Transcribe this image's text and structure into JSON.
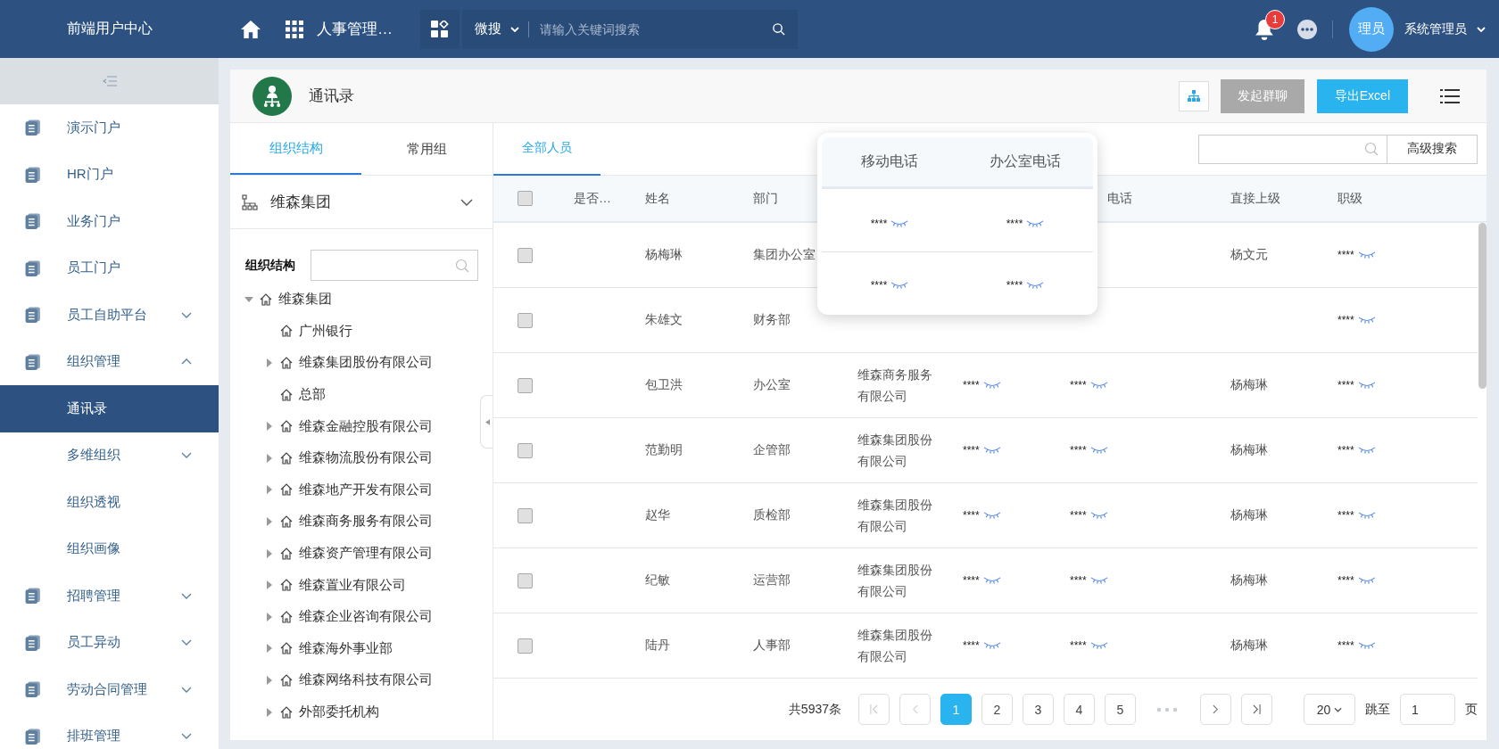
{
  "topbar": {
    "brand": "前端用户中心",
    "module": "人事管理…",
    "search": {
      "scope": "微搜",
      "placeholder": "请输入关键词搜索"
    },
    "notifications": "1",
    "user": {
      "avatar_text": "理员",
      "name": "系统管理员"
    }
  },
  "sidebar": {
    "items": [
      {
        "label": "演示门户",
        "kind": "page",
        "selected": false
      },
      {
        "label": "HR门户",
        "kind": "page",
        "selected": false
      },
      {
        "label": "业务门户",
        "kind": "page",
        "selected": false
      },
      {
        "label": "员工门户",
        "kind": "page",
        "selected": false
      },
      {
        "label": "员工自助平台",
        "kind": "folder",
        "expanded": false,
        "selected": false
      },
      {
        "label": "组织管理",
        "kind": "folder",
        "expanded": true,
        "selected": false
      },
      {
        "label": "通讯录",
        "kind": "sub",
        "selected": true
      },
      {
        "label": "多维组织",
        "kind": "subfolder",
        "expanded": false,
        "selected": false
      },
      {
        "label": "组织透视",
        "kind": "sub",
        "selected": false
      },
      {
        "label": "组织画像",
        "kind": "sub",
        "selected": false
      },
      {
        "label": "招聘管理",
        "kind": "folder",
        "expanded": false,
        "selected": false
      },
      {
        "label": "员工异动",
        "kind": "folder",
        "expanded": false,
        "selected": false
      },
      {
        "label": "劳动合同管理",
        "kind": "folder",
        "expanded": false,
        "selected": false
      },
      {
        "label": "排班管理",
        "kind": "folder",
        "expanded": false,
        "selected": false
      }
    ]
  },
  "page": {
    "title": "通讯录",
    "actions": [
      {
        "label": "发起群聊",
        "disabled": true
      },
      {
        "label": "导出Excel",
        "disabled": false
      }
    ]
  },
  "tree_panel": {
    "tabs": [
      {
        "label": "组织结构",
        "selected": true
      },
      {
        "label": "常用组",
        "selected": false
      }
    ],
    "org_select": "维森集团",
    "search_label": "组织结构",
    "tree": [
      {
        "label": "维森集团",
        "expanded": true,
        "children": [
          {
            "label": "广州银行"
          },
          {
            "label": "维森集团股份有限公司",
            "expanded": false
          },
          {
            "label": "总部"
          },
          {
            "label": "维森金融控股有限公司",
            "expanded": false
          },
          {
            "label": "维森物流股份有限公司",
            "expanded": false
          },
          {
            "label": "维森地产开发有限公司",
            "expanded": false
          },
          {
            "label": "维森商务服务有限公司",
            "expanded": false
          },
          {
            "label": "维森资产管理有限公司",
            "expanded": false
          },
          {
            "label": "维森置业有限公司",
            "expanded": false
          },
          {
            "label": "维森企业咨询有限公司",
            "expanded": false
          },
          {
            "label": "维森海外事业部",
            "expanded": false
          },
          {
            "label": "维森网络科技有限公司",
            "expanded": false
          },
          {
            "label": "外部委托机构",
            "expanded": false
          }
        ]
      }
    ]
  },
  "people": {
    "tabs": [
      {
        "label": "全部人员",
        "selected": true
      }
    ],
    "advanced_search": "高级搜索",
    "table": {
      "select_all": {
        "checked": false
      },
      "columns": [
        {
          "label": "是否…"
        },
        {
          "label": "姓名"
        },
        {
          "label": "部门"
        },
        {},
        {},
        {
          "label": "电话"
        },
        {
          "label": "直接上级"
        },
        {
          "label": "职级"
        }
      ],
      "rows": [
        {
          "checked": false,
          "name": "杨梅琳",
          "dept": "集团办公室",
          "supervisor": "杨文元",
          "rank": "****"
        },
        {
          "checked": false,
          "name": "朱雄文",
          "dept": "财务部",
          "rank": "****"
        },
        {
          "checked": false,
          "name": "包卫洪",
          "dept": "办公室",
          "company": [
            "维森商务服务",
            "有限公司"
          ],
          "mobile": "****",
          "office": "****",
          "supervisor": "杨梅琳",
          "rank": "****"
        },
        {
          "checked": false,
          "name": "范勤明",
          "dept": "企管部",
          "company": [
            "维森集团股份",
            "有限公司"
          ],
          "mobile": "****",
          "office": "****",
          "supervisor": "杨梅琳",
          "rank": "****"
        },
        {
          "checked": false,
          "name": "赵华",
          "dept": "质检部",
          "company": [
            "维森集团股份",
            "有限公司"
          ],
          "mobile": "****",
          "office": "****",
          "supervisor": "杨梅琳",
          "rank": "****"
        },
        {
          "checked": false,
          "name": "纪敏",
          "dept": "运营部",
          "company": [
            "维森集团股份",
            "有限公司"
          ],
          "mobile": "****",
          "office": "****",
          "supervisor": "杨梅琳",
          "rank": "****"
        },
        {
          "checked": false,
          "name": "陆丹",
          "dept": "人事部",
          "company": [
            "维森集团股份",
            "有限公司"
          ],
          "mobile": "****",
          "office": "****",
          "supervisor": "杨梅琳",
          "rank": "****"
        }
      ]
    },
    "popup": {
      "columns": [
        "移动电话",
        "办公室电话"
      ],
      "rows": [
        {
          "mobile": "****",
          "office": "****"
        },
        {
          "mobile": "****",
          "office": "****"
        }
      ]
    }
  },
  "pagination": {
    "total": "共5937条",
    "pages": [
      {
        "label": "1",
        "selected": true
      },
      {
        "label": "2",
        "selected": false
      },
      {
        "label": "3",
        "selected": false
      },
      {
        "label": "4",
        "selected": false
      },
      {
        "label": "5",
        "selected": false
      }
    ],
    "page_size": "20",
    "jump_label": "跳至",
    "jump_value": "1",
    "page_suffix": "页"
  }
}
